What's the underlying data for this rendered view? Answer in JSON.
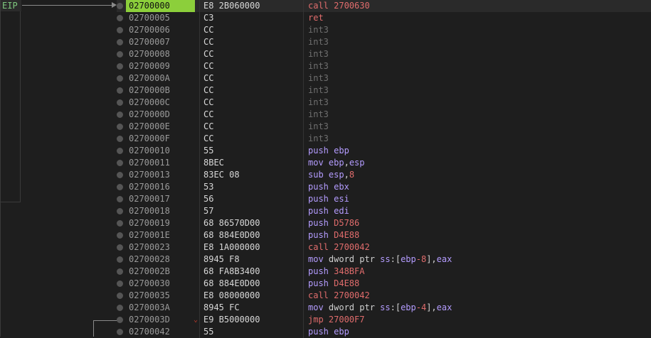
{
  "eip_label": "EIP",
  "rows": [
    {
      "addr": "02700000",
      "bytes": "E8 2B060000",
      "instr": [
        {
          "t": "call ",
          "c": "c-call"
        },
        {
          "t": "2700630",
          "c": "imm"
        }
      ]
    },
    {
      "addr": "02700005",
      "bytes": "C3",
      "instr": [
        {
          "t": "ret",
          "c": "c-ret"
        }
      ]
    },
    {
      "addr": "02700006",
      "bytes": "CC",
      "instr": [
        {
          "t": "int3",
          "c": "c-int3"
        }
      ]
    },
    {
      "addr": "02700007",
      "bytes": "CC",
      "instr": [
        {
          "t": "int3",
          "c": "c-int3"
        }
      ]
    },
    {
      "addr": "02700008",
      "bytes": "CC",
      "instr": [
        {
          "t": "int3",
          "c": "c-int3"
        }
      ]
    },
    {
      "addr": "02700009",
      "bytes": "CC",
      "instr": [
        {
          "t": "int3",
          "c": "c-int3"
        }
      ]
    },
    {
      "addr": "0270000A",
      "bytes": "CC",
      "instr": [
        {
          "t": "int3",
          "c": "c-int3"
        }
      ]
    },
    {
      "addr": "0270000B",
      "bytes": "CC",
      "instr": [
        {
          "t": "int3",
          "c": "c-int3"
        }
      ]
    },
    {
      "addr": "0270000C",
      "bytes": "CC",
      "instr": [
        {
          "t": "int3",
          "c": "c-int3"
        }
      ]
    },
    {
      "addr": "0270000D",
      "bytes": "CC",
      "instr": [
        {
          "t": "int3",
          "c": "c-int3"
        }
      ]
    },
    {
      "addr": "0270000E",
      "bytes": "CC",
      "instr": [
        {
          "t": "int3",
          "c": "c-int3"
        }
      ]
    },
    {
      "addr": "0270000F",
      "bytes": "CC",
      "instr": [
        {
          "t": "int3",
          "c": "c-int3"
        }
      ]
    },
    {
      "addr": "02700010",
      "bytes": "55",
      "instr": [
        {
          "t": "push ",
          "c": "c-push"
        },
        {
          "t": "ebp",
          "c": "reg"
        }
      ]
    },
    {
      "addr": "02700011",
      "bytes": "8BEC",
      "instr": [
        {
          "t": "mov ",
          "c": "c-mov"
        },
        {
          "t": "ebp",
          "c": "reg"
        },
        {
          "t": ",",
          "c": "plain"
        },
        {
          "t": "esp",
          "c": "reg"
        }
      ]
    },
    {
      "addr": "02700013",
      "bytes": "83EC 08",
      "instr": [
        {
          "t": "sub ",
          "c": "c-sub"
        },
        {
          "t": "esp",
          "c": "reg"
        },
        {
          "t": ",",
          "c": "plain"
        },
        {
          "t": "8",
          "c": "imm"
        }
      ]
    },
    {
      "addr": "02700016",
      "bytes": "53",
      "instr": [
        {
          "t": "push ",
          "c": "c-push"
        },
        {
          "t": "ebx",
          "c": "reg"
        }
      ]
    },
    {
      "addr": "02700017",
      "bytes": "56",
      "instr": [
        {
          "t": "push ",
          "c": "c-push"
        },
        {
          "t": "esi",
          "c": "reg"
        }
      ]
    },
    {
      "addr": "02700018",
      "bytes": "57",
      "instr": [
        {
          "t": "push ",
          "c": "c-push"
        },
        {
          "t": "edi",
          "c": "reg"
        }
      ]
    },
    {
      "addr": "02700019",
      "bytes": "68 86570D00",
      "instr": [
        {
          "t": "push ",
          "c": "c-push"
        },
        {
          "t": "D5786",
          "c": "imm"
        }
      ]
    },
    {
      "addr": "0270001E",
      "bytes": "68 884E0D00",
      "instr": [
        {
          "t": "push ",
          "c": "c-push"
        },
        {
          "t": "D4E88",
          "c": "imm"
        }
      ]
    },
    {
      "addr": "02700023",
      "bytes": "E8 1A000000",
      "instr": [
        {
          "t": "call ",
          "c": "c-call"
        },
        {
          "t": "2700042",
          "c": "imm"
        }
      ]
    },
    {
      "addr": "02700028",
      "bytes": "8945 F8",
      "instr": [
        {
          "t": "mov ",
          "c": "c-mov"
        },
        {
          "t": "dword ptr ",
          "c": "plain"
        },
        {
          "t": "ss",
          "c": "reg"
        },
        {
          "t": ":[",
          "c": "plain"
        },
        {
          "t": "ebp",
          "c": "reg"
        },
        {
          "t": "-8",
          "c": "imm"
        },
        {
          "t": "],",
          "c": "plain"
        },
        {
          "t": "eax",
          "c": "reg"
        }
      ]
    },
    {
      "addr": "0270002B",
      "bytes": "68 FA8B3400",
      "instr": [
        {
          "t": "push ",
          "c": "c-push"
        },
        {
          "t": "348BFA",
          "c": "imm"
        }
      ]
    },
    {
      "addr": "02700030",
      "bytes": "68 884E0D00",
      "instr": [
        {
          "t": "push ",
          "c": "c-push"
        },
        {
          "t": "D4E88",
          "c": "imm"
        }
      ]
    },
    {
      "addr": "02700035",
      "bytes": "E8 08000000",
      "instr": [
        {
          "t": "call ",
          "c": "c-call"
        },
        {
          "t": "2700042",
          "c": "imm"
        }
      ]
    },
    {
      "addr": "0270003A",
      "bytes": "8945 FC",
      "instr": [
        {
          "t": "mov ",
          "c": "c-mov"
        },
        {
          "t": "dword ptr ",
          "c": "plain"
        },
        {
          "t": "ss",
          "c": "reg"
        },
        {
          "t": ":[",
          "c": "plain"
        },
        {
          "t": "ebp",
          "c": "reg"
        },
        {
          "t": "-4",
          "c": "imm"
        },
        {
          "t": "],",
          "c": "plain"
        },
        {
          "t": "eax",
          "c": "reg"
        }
      ]
    },
    {
      "addr": "0270003D",
      "bytes": "E9 B5000000",
      "jump": "⌄",
      "instr": [
        {
          "t": "jmp ",
          "c": "c-jmp"
        },
        {
          "t": "27000F7",
          "c": "imm"
        }
      ]
    },
    {
      "addr": "02700042",
      "bytes": "55",
      "instr": [
        {
          "t": "push ",
          "c": "c-push"
        },
        {
          "t": "ebp",
          "c": "reg"
        }
      ]
    }
  ]
}
